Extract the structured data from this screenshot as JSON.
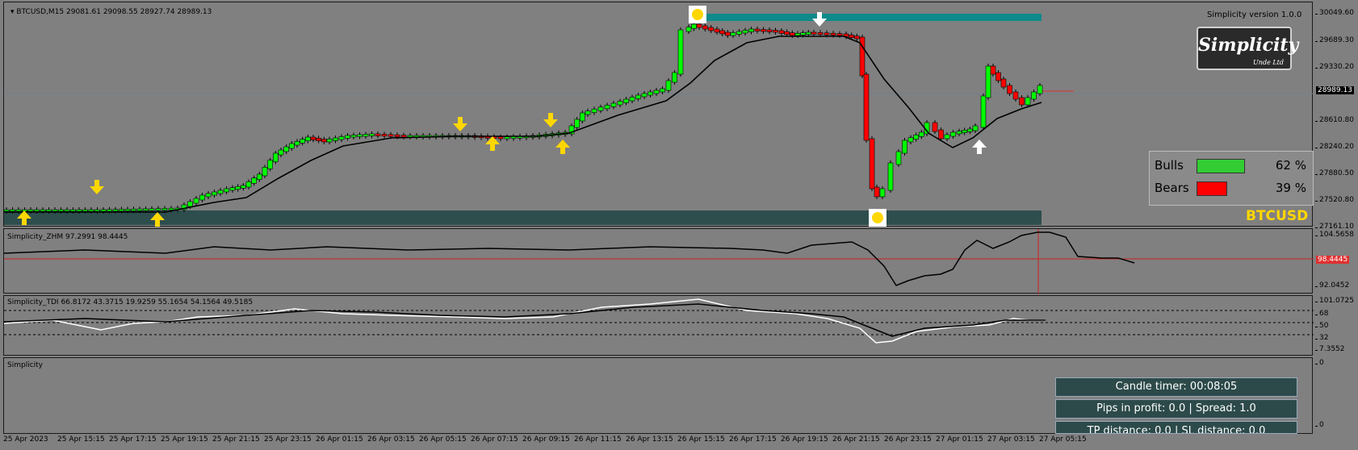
{
  "main": {
    "header_symbol": "BTCUSD,M15",
    "header_ohlc": "29081.61 29098.55 28927.74 28989.13",
    "version_text": "Simplicity version 1.0.0",
    "logo_text": "Simplicity",
    "logo_sub": "Unde Ltd",
    "price_ticks": [
      "30049.60",
      "29689.30",
      "29330.20",
      "28610.80",
      "28240.20",
      "27880.50",
      "27520.80",
      "27161.10"
    ],
    "current_price": "28989.13",
    "bulls_label": "Bulls",
    "bulls_pct": "62 %",
    "bulls_value": 62,
    "bulls_color": "#33cc33",
    "bears_label": "Bears",
    "bears_pct": "39 %",
    "bears_value": 39,
    "bears_color": "#ff0000",
    "symbol_label": "BTCUSD",
    "symbol_color": "#ffd700"
  },
  "zhm": {
    "label": "Simplicity_ZHM 97.2991 98.4445",
    "ticks": [
      "104.5658",
      "92.0452"
    ],
    "current": "98.4445"
  },
  "tdi": {
    "label": "Simplicity_TDI 66.8172 43.3715 19.9259 55.1654 54.1564 49.5185",
    "ticks": [
      "101.0725",
      "68",
      "50",
      "32",
      "7.3552"
    ]
  },
  "simplicity": {
    "label": "Simplicity",
    "ticks": [
      "0",
      "0"
    ],
    "candle_timer": "Candle timer: 00:08:05",
    "pips": "Pips in profit: 0.0 | Spread: 1.0",
    "tp_sl": "TP distance: 0.0 | SL distance: 0.0"
  },
  "time_axis": [
    "25 Apr 2023",
    "25 Apr 15:15",
    "25 Apr 17:15",
    "25 Apr 19:15",
    "25 Apr 21:15",
    "25 Apr 23:15",
    "26 Apr 01:15",
    "26 Apr 03:15",
    "26 Apr 05:15",
    "26 Apr 07:15",
    "26 Apr 09:15",
    "26 Apr 11:15",
    "26 Apr 13:15",
    "26 Apr 15:15",
    "26 Apr 17:15",
    "26 Apr 19:15",
    "26 Apr 21:15",
    "26 Apr 23:15",
    "27 Apr 01:15",
    "27 Apr 03:15",
    "27 Apr 05:15"
  ],
  "colors": {
    "bull": "#00ff00",
    "bear": "#ff0000",
    "band_top": "#0e8a8a",
    "band_bottom": "#2e4e4e",
    "arrow": "#ffd700"
  }
}
